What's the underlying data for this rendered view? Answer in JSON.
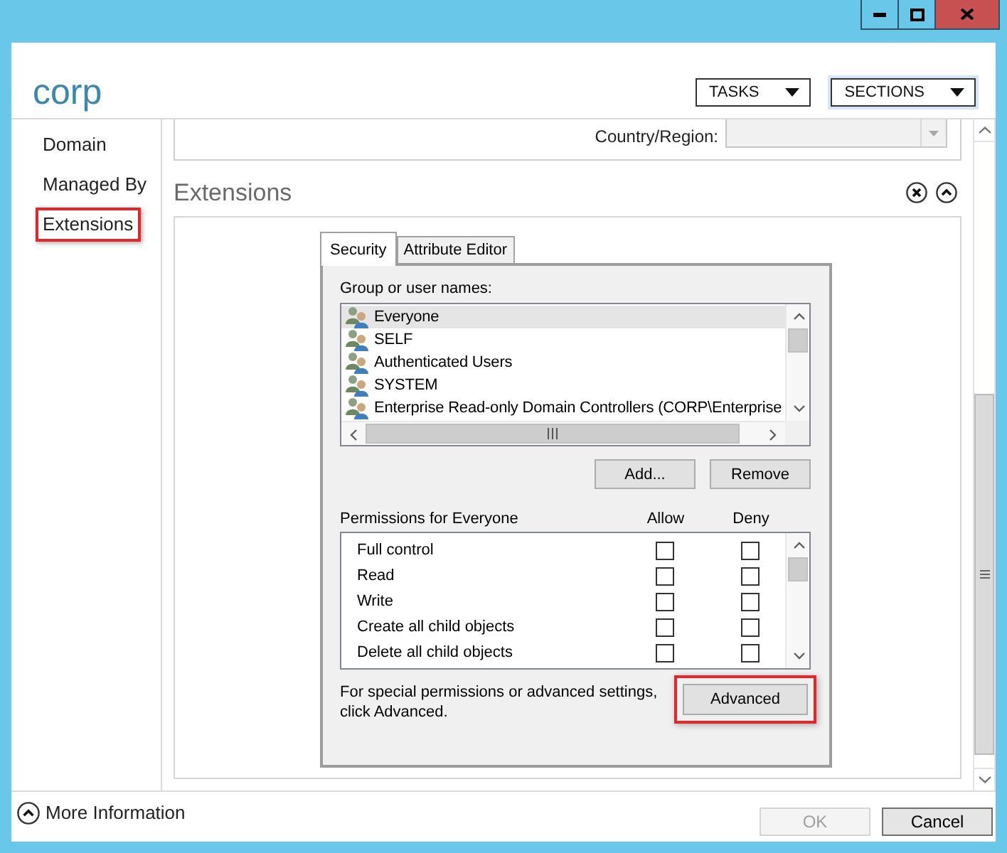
{
  "header": {
    "title": "corp",
    "menus": [
      {
        "label": "TASKS",
        "focused": false
      },
      {
        "label": "SECTIONS",
        "focused": true
      }
    ]
  },
  "sidebar": {
    "items": [
      {
        "label": "Domain",
        "highlighted": false
      },
      {
        "label": "Managed By",
        "highlighted": false
      },
      {
        "label": "Extensions",
        "highlighted": true
      }
    ]
  },
  "address_section": {
    "country_label": "Country/Region:",
    "country_disabled": true
  },
  "extensions": {
    "title": "Extensions",
    "tabs": [
      {
        "label": "Security",
        "selected": true
      },
      {
        "label": "Attribute Editor",
        "selected": false
      }
    ],
    "group_label": "Group or user names:",
    "principals": [
      {
        "name": "Everyone",
        "selected": true
      },
      {
        "name": "SELF",
        "selected": false
      },
      {
        "name": "Authenticated Users",
        "selected": false
      },
      {
        "name": "SYSTEM",
        "selected": false
      },
      {
        "name": "Enterprise Read-only Domain Controllers (CORP\\Enterprise",
        "selected": false
      }
    ],
    "principal_buttons": [
      "Add...",
      "Remove"
    ],
    "permissions_label": "Permissions for Everyone",
    "columns": [
      "Allow",
      "Deny"
    ],
    "permissions": [
      {
        "name": "Full control",
        "allow": false,
        "deny": false
      },
      {
        "name": "Read",
        "allow": false,
        "deny": false
      },
      {
        "name": "Write",
        "allow": false,
        "deny": false
      },
      {
        "name": "Create all child objects",
        "allow": false,
        "deny": false
      },
      {
        "name": "Delete all child objects",
        "allow": false,
        "deny": false
      }
    ],
    "note": "For special permissions or advanced settings, click Advanced.",
    "advanced_button": {
      "label": "Advanced",
      "highlighted": true
    }
  },
  "footer": {
    "more_info": "More Information",
    "buttons": [
      {
        "label": "OK",
        "disabled": true
      },
      {
        "label": "Cancel",
        "disabled": false
      }
    ]
  }
}
